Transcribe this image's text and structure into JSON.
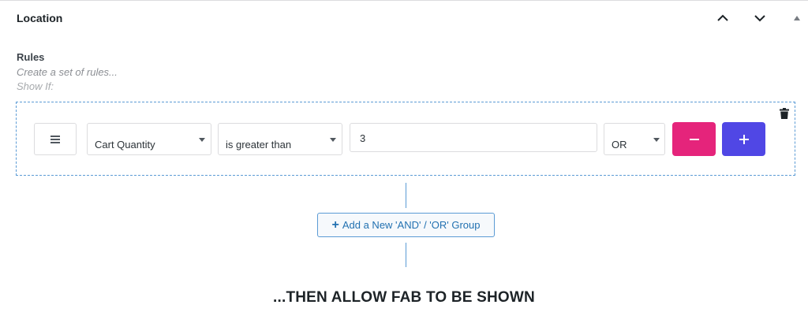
{
  "panel": {
    "title": "Location",
    "move_up_icon": "chevron-up-icon",
    "move_down_icon": "chevron-down-icon",
    "toggle_icon": "triangle-up-icon"
  },
  "rules": {
    "label": "Rules",
    "description": "Create a set of rules...",
    "show_if": "Show If:"
  },
  "rule_row": {
    "drag_icon": "hamburger-icon",
    "type_value": "Cart Quantity",
    "operator_value": "is greater than",
    "input_value": "3",
    "logic_value": "OR",
    "remove_icon": "minus-icon",
    "add_icon": "plus-icon",
    "delete_group_icon": "trash-icon"
  },
  "add_group_button": {
    "label": "Add a New 'AND' / 'OR' Group",
    "icon": "plus-icon"
  },
  "footer_text": "...THEN ALLOW FAB TO BE SHOWN",
  "colors": {
    "remove_button": "#e5247b",
    "add_button": "#5047e5",
    "link_blue": "#2271b1",
    "dashed_border": "#5b9bd5"
  }
}
